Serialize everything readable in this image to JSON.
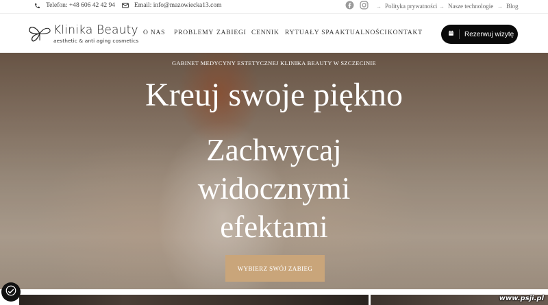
{
  "topbar": {
    "phone_label": "Telefon: +48 606 42 42 94",
    "email_label": "Email: info@mazowiecka13.com",
    "links": [
      {
        "label": "Polityka prywatności"
      },
      {
        "label": "Nasze technologie"
      },
      {
        "label": "Blog"
      }
    ]
  },
  "logo": {
    "title": "Klinika Beauty",
    "subtitle": "aesthetic & anti aging cosmetics"
  },
  "nav": {
    "items": [
      {
        "label": "O NAS"
      },
      {
        "label": "PROBLEMY"
      },
      {
        "label": "ZABIEGI"
      },
      {
        "label": "CENNIK"
      },
      {
        "label": "RYTUAŁY SPA"
      },
      {
        "label": "AKTUALNOŚCI"
      },
      {
        "label": "KONTAKT"
      }
    ],
    "book_button": "Rezerwuj wizytę"
  },
  "hero": {
    "kicker": "GABINET MEDYCYNY ESTETYCZNEJ KLINIKA BEAUTY W SZCZECINIE",
    "headline": "Kreuj swoje piękno",
    "subheadline_lines": [
      "Zachwycaj",
      "widocznymi",
      "efektami"
    ],
    "cta_label": "WYBIERZ SWÓJ ZABIEG"
  },
  "watermark": "www.psji.pl",
  "colors": {
    "accent_gold": "#c9a57a",
    "button_dark": "#0a0a0a",
    "text_dark": "#333333"
  },
  "icons": [
    "phone-icon",
    "mail-icon",
    "facebook-icon",
    "instagram-icon",
    "calendar-icon",
    "accessibility-icon"
  ]
}
